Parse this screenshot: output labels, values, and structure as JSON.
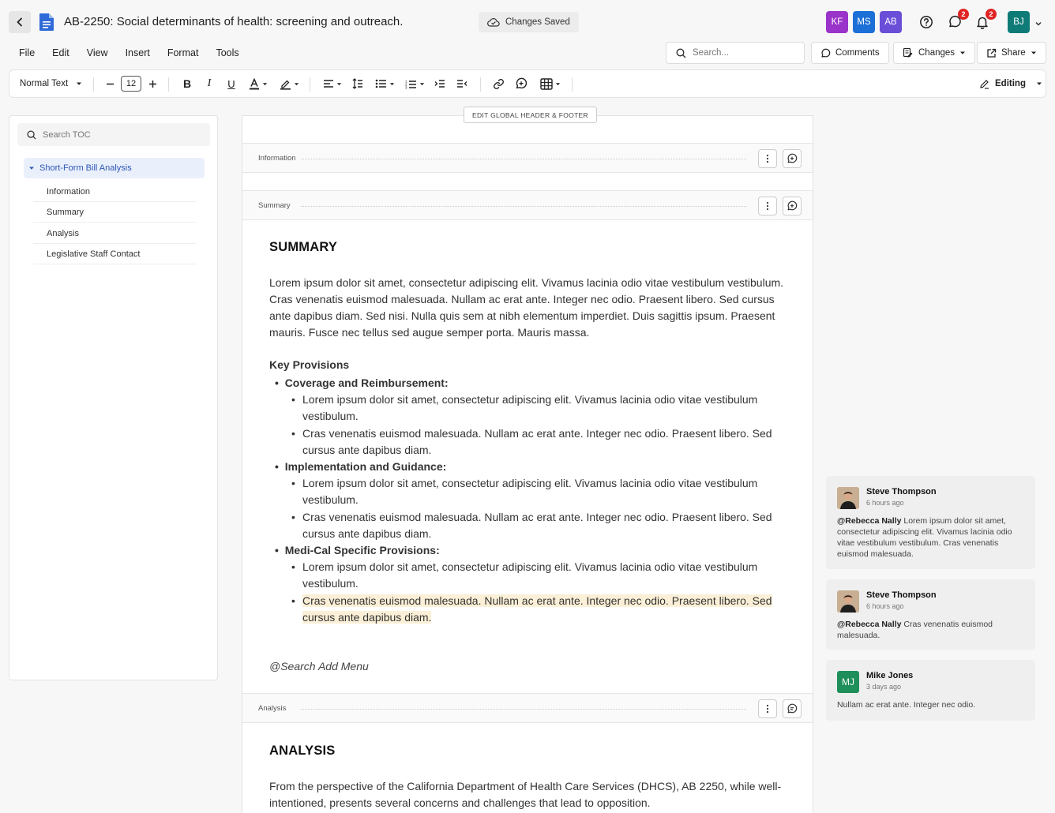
{
  "header": {
    "title": "AB-2250: Social determinants of health: screening and outreach.",
    "save_status": "Changes Saved",
    "collaborators": [
      {
        "initials": "KF",
        "color": "#9a33c9"
      },
      {
        "initials": "MS",
        "color": "#1c6fd6"
      },
      {
        "initials": "AB",
        "color": "#6a4ed8"
      }
    ],
    "comments_badge": "2",
    "notifications_badge": "2",
    "user_initials": "BJ",
    "user_color": "#0f7b77"
  },
  "menu": {
    "items": [
      "File",
      "Edit",
      "View",
      "Insert",
      "Format",
      "Tools"
    ]
  },
  "actions": {
    "search_placeholder": "Search...",
    "comments_label": "Comments",
    "changes_label": "Changes",
    "share_label": "Share"
  },
  "toolbar": {
    "style_label": "Normal Text",
    "font_size": "12",
    "mode_label": "Editing"
  },
  "toc": {
    "search_placeholder": "Search TOC",
    "root": "Short-Form Bill Analysis",
    "items": [
      "Information",
      "Summary",
      "Analysis",
      "Legislative Staff Contact"
    ]
  },
  "document": {
    "header_footer_button": "EDIT GLOBAL HEADER & FOOTER",
    "sections": {
      "information": "Information",
      "summary": "Summary",
      "analysis": "Analysis"
    },
    "summary_heading": "SUMMARY",
    "summary_paragraph": "Lorem ipsum dolor sit amet, consectetur adipiscing elit. Vivamus lacinia odio vitae vestibulum vestibulum. Cras venenatis euismod malesuada. Nullam ac erat ante. Integer nec odio. Praesent libero. Sed cursus ante dapibus diam. Sed nisi. Nulla quis sem at nibh elementum imperdiet. Duis sagittis ipsum. Praesent mauris. Fusce nec tellus sed augue semper porta. Mauris massa.",
    "key_provisions_title": "Key Provisions",
    "provisions": [
      {
        "title": "Coverage and Reimbursement:",
        "items": [
          "Lorem ipsum dolor sit amet, consectetur adipiscing elit. Vivamus lacinia odio vitae vestibulum vestibulum.",
          "Cras venenatis euismod malesuada. Nullam ac erat ante. Integer nec odio. Praesent libero. Sed cursus ante dapibus diam."
        ]
      },
      {
        "title": "Implementation and Guidance:",
        "items": [
          "Lorem ipsum dolor sit amet, consectetur adipiscing elit. Vivamus lacinia odio vitae vestibulum vestibulum.",
          "Cras venenatis euismod malesuada. Nullam ac erat ante. Integer nec odio. Praesent libero. Sed cursus ante dapibus diam."
        ]
      },
      {
        "title": "Medi-Cal Specific Provisions:",
        "items": [
          "Lorem ipsum dolor sit amet, consectetur adipiscing elit. Vivamus lacinia odio vitae vestibulum vestibulum.",
          "Cras venenatis euismod malesuada. Nullam ac erat ante. Integer nec odio. Praesent libero. Sed cursus ante dapibus diam."
        ]
      }
    ],
    "add_menu_prompt": "@Search Add Menu",
    "analysis_heading": "ANALYSIS",
    "analysis_paragraph": "From the perspective of the California Department of Health Care Services (DHCS), AB 2250, while well-intentioned, presents several concerns and challenges that lead to opposition."
  },
  "comments": [
    {
      "author": "Steve Thompson",
      "time": "6 hours ago",
      "mention": "@Rebecca Nally",
      "text": "Lorem ipsum dolor sit amet, consectetur adipiscing elit. Vivamus lacinia odio vitae vestibulum vestibulum. Cras venenatis euismod malesuada."
    },
    {
      "author": "Steve Thompson",
      "time": "6 hours ago",
      "mention": "@Rebecca Nally",
      "text": "Cras venenatis euismod malesuada."
    },
    {
      "author": "Mike Jones",
      "time": "3 days ago",
      "initials": "MJ",
      "color": "#1e8f5a",
      "text": "Nullam ac erat ante. Integer nec odio."
    }
  ]
}
